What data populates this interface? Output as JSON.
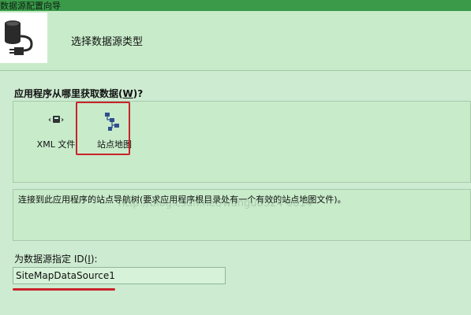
{
  "window": {
    "title": "数据源配置向导"
  },
  "header": {
    "logo_icon": "database-plug-icon",
    "title": "选择数据源类型"
  },
  "section": {
    "label_prefix": "应用程序从哪里获取数据(",
    "label_key": "W",
    "label_suffix": ")?"
  },
  "sources": {
    "items": [
      {
        "label": "XML 文件",
        "icon": "xml-file-icon"
      },
      {
        "label": "站点地图",
        "icon": "site-map-icon",
        "selected": true
      }
    ]
  },
  "description": {
    "text": "连接到此应用程序的站点导航树(要求应用程序根目录处有一个有效的站点地图文件)。"
  },
  "id_field": {
    "label_prefix": "为数据源指定 ID(",
    "label_key": "I",
    "label_suffix": "):",
    "value": "SiteMapDataSource1"
  },
  "watermark": {
    "text": "http://blog.csdn.net/wangu8524 0614"
  },
  "colors": {
    "title_bar": "#3a9a4a",
    "background": "#cdebd0",
    "highlight": "#c8232b"
  }
}
